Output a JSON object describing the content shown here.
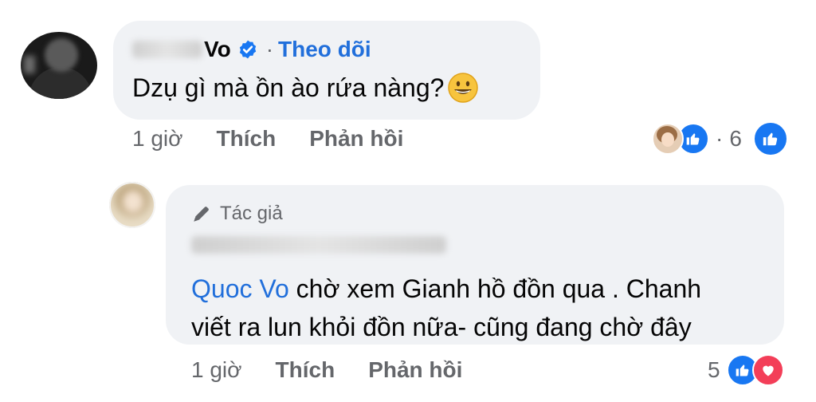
{
  "comment1": {
    "author_visible_tail": "Vo",
    "follow_separator": "·",
    "follow_label": "Theo dõi",
    "text": "Dzụ gì mà ồn ào rứa nàng?",
    "time": "1 giờ",
    "like_label": "Thích",
    "reply_label": "Phản hồi",
    "reaction_separator": "·",
    "reaction_count": "6"
  },
  "comment2": {
    "author_badge": "Tác giả",
    "mention": "Quoc Vo",
    "text_line1": " chờ xem Gianh hồ đồn qua . Chanh",
    "text_line2": "viết ra lun khỏi đồn nữa- cũng đang chờ đây",
    "time": "1 giờ",
    "like_label": "Thích",
    "reply_label": "Phản hồi",
    "reaction_count": "5"
  },
  "colors": {
    "bubble": "#f0f2f5",
    "link_blue": "#216fdb",
    "secondary_text": "#65676b",
    "like_blue": "#1877f2",
    "love_red": "#f33e58"
  },
  "icons": [
    "verified-badge-icon",
    "grinning-emoji-icon",
    "like-reaction-icon",
    "love-reaction-icon",
    "pen-icon"
  ]
}
